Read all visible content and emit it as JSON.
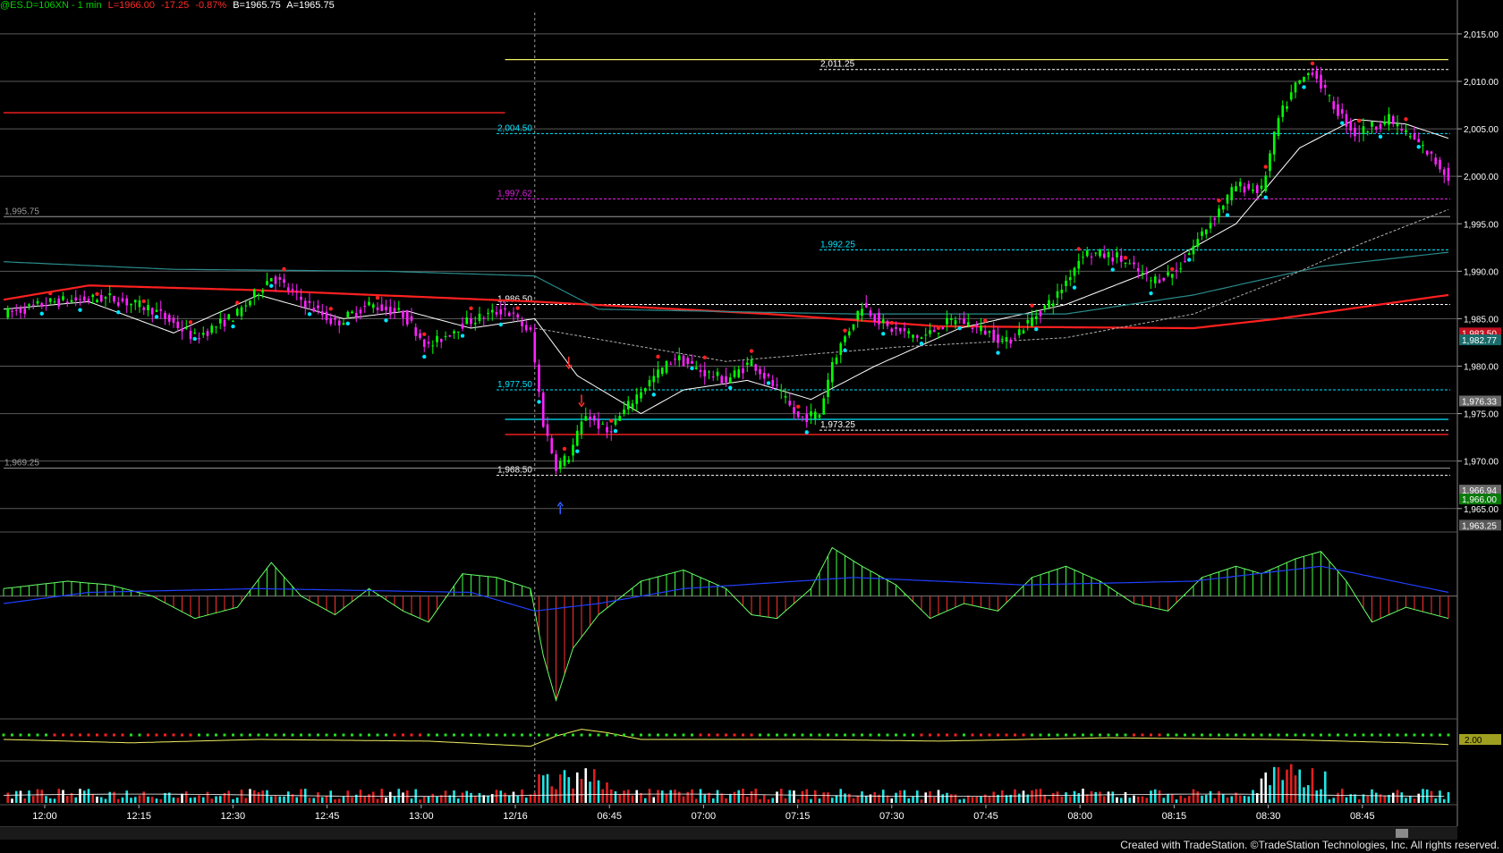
{
  "header": {
    "symbol_interval": "@ES.D=106XN - 1 min",
    "last": "L=1966.00",
    "change": "-17.25",
    "change_pct": "-0.87%",
    "bid": "B=1965.75",
    "ask": "A=1965.75"
  },
  "footer": {
    "credit": "Created with TradeStation. ©TradeStation Technologies, Inc. All rights reserved."
  },
  "colors": {
    "background": "#000000",
    "up_candle": "#00ff00",
    "down_candle": "#ff22ff",
    "ma_red": "#ff2020",
    "ma_white": "#ffffff",
    "teal_band": "#2a8c8c",
    "level_cyan": "#00e5ff",
    "level_magenta": "#e020e0",
    "level_yellow": "#f0f060",
    "hist_up": "#40ff40",
    "hist_down": "#ff3030",
    "signal_blue": "#2040ff",
    "vol_cyan": "#20e5e5",
    "vol_red": "#e02020",
    "vol_white": "#ffffff"
  },
  "chart_data": [
    {
      "panel": "price",
      "type": "candlestick",
      "x_ticks": [
        "12:00",
        "12:15",
        "12:30",
        "12:45",
        "13:00",
        "12/16",
        "06:45",
        "07:00",
        "07:15",
        "07:30",
        "07:45",
        "08:00",
        "08:15",
        "08:30",
        "08:45"
      ],
      "y_ticks": [
        1965,
        1970,
        1975,
        1980,
        1985,
        1990,
        1995,
        2000,
        2005,
        2010,
        2015
      ],
      "y_tick_labels": [
        "1,965.00",
        "1,970.00",
        "1,975.00",
        "1,980.00",
        "1,985.00",
        "1,990.00",
        "1,995.00",
        "2,000.00",
        "2,005.00",
        "2,010.00",
        "2,015.00"
      ],
      "ylim": [
        1963,
        2016.5
      ],
      "close_path": [
        [
          0,
          1985.5
        ],
        [
          12,
          1986.8
        ],
        [
          25,
          1987.2
        ],
        [
          35,
          1986.0
        ],
        [
          45,
          1983.0
        ],
        [
          55,
          1985.5
        ],
        [
          63,
          1989.5
        ],
        [
          70,
          1987.0
        ],
        [
          78,
          1984.5
        ],
        [
          86,
          1986.5
        ],
        [
          94,
          1985.5
        ],
        [
          100,
          1982.0
        ],
        [
          108,
          1984.5
        ],
        [
          118,
          1986.0
        ],
        [
          124,
          1983.5
        ],
        [
          127,
          1974.0
        ],
        [
          130,
          1969.5
        ],
        [
          133,
          1970.5
        ],
        [
          137,
          1975.0
        ],
        [
          142,
          1973.0
        ],
        [
          150,
          1977.5
        ],
        [
          158,
          1981.0
        ],
        [
          164,
          1979.5
        ],
        [
          170,
          1978.5
        ],
        [
          176,
          1980.5
        ],
        [
          182,
          1977.5
        ],
        [
          187,
          1974.5
        ],
        [
          192,
          1975.0
        ],
        [
          195,
          1980.5
        ],
        [
          202,
          1986.5
        ],
        [
          208,
          1984.0
        ],
        [
          216,
          1983.0
        ],
        [
          224,
          1985.0
        ],
        [
          232,
          1983.5
        ],
        [
          236,
          1982.5
        ],
        [
          242,
          1985.0
        ],
        [
          248,
          1987.5
        ],
        [
          254,
          1992.0
        ],
        [
          262,
          1991.5
        ],
        [
          270,
          1989.0
        ],
        [
          276,
          1990.0
        ],
        [
          282,
          1994.0
        ],
        [
          290,
          1999.0
        ],
        [
          296,
          1998.5
        ],
        [
          300,
          2006.0
        ],
        [
          304,
          2009.5
        ],
        [
          308,
          2011.25
        ],
        [
          312,
          2008.0
        ],
        [
          318,
          2004.5
        ],
        [
          326,
          2006.0
        ],
        [
          334,
          2003.0
        ],
        [
          340,
          2000.0
        ]
      ],
      "candle_count": 340,
      "session_break_index": 125,
      "moving_averages": [
        {
          "color": "red",
          "path": [
            [
              0,
              1987.0
            ],
            [
              20,
              1988.5
            ],
            [
              60,
              1988.0
            ],
            [
              125,
              1986.8
            ],
            [
              180,
              1985.5
            ],
            [
              220,
              1984.2
            ],
            [
              280,
              1984.0
            ],
            [
              300,
              1985.0
            ],
            [
              340,
              1987.5
            ]
          ]
        },
        {
          "color": "white",
          "path": [
            [
              0,
              1986.0
            ],
            [
              20,
              1986.8
            ],
            [
              40,
              1983.5
            ],
            [
              60,
              1987.5
            ],
            [
              80,
              1985.0
            ],
            [
              95,
              1985.8
            ],
            [
              110,
              1984.0
            ],
            [
              125,
              1985.0
            ],
            [
              135,
              1979.0
            ],
            [
              150,
              1975.0
            ],
            [
              160,
              1977.5
            ],
            [
              175,
              1978.5
            ],
            [
              190,
              1976.5
            ],
            [
              205,
              1980.0
            ],
            [
              225,
              1984.0
            ],
            [
              250,
              1986.5
            ],
            [
              270,
              1990.0
            ],
            [
              290,
              1995.0
            ],
            [
              305,
              2003.0
            ],
            [
              318,
              2006.0
            ],
            [
              330,
              2005.5
            ],
            [
              340,
              2004.0
            ]
          ]
        },
        {
          "color": "teal",
          "path": [
            [
              0,
              1991.0
            ],
            [
              40,
              1990.2
            ],
            [
              90,
              1990.0
            ],
            [
              125,
              1989.5
            ],
            [
              140,
              1986.0
            ],
            [
              200,
              1985.5
            ],
            [
              250,
              1985.5
            ],
            [
              280,
              1987.5
            ],
            [
              310,
              1990.5
            ],
            [
              340,
              1992.0
            ]
          ]
        },
        {
          "color": "grey-dashed",
          "path": [
            [
              125,
              1984.0
            ],
            [
              170,
              1980.5
            ],
            [
              210,
              1982.0
            ],
            [
              250,
              1983.0
            ],
            [
              280,
              1985.5
            ],
            [
              300,
              1989.0
            ],
            [
              320,
              1993.0
            ],
            [
              340,
              1996.5
            ]
          ]
        }
      ],
      "levels": [
        {
          "label": "2,011.25",
          "value": 2011.25,
          "color": "white",
          "style": "dashed",
          "x_start_index": 192
        },
        {
          "label": "2,004.50",
          "value": 2004.5,
          "color": "cyan",
          "style": "dashed",
          "x_start_index": 116
        },
        {
          "label": "1,997.62",
          "value": 1997.62,
          "color": "magenta",
          "style": "dashed",
          "x_start_index": 116
        },
        {
          "label": "1,992.25",
          "value": 1992.25,
          "color": "cyan",
          "style": "dashed",
          "x_start_index": 192
        },
        {
          "label": "1,986.50",
          "value": 1986.5,
          "color": "white",
          "style": "dashed",
          "x_start_index": 116
        },
        {
          "label": "1,977.50",
          "value": 1977.5,
          "color": "cyan",
          "style": "dashed",
          "x_start_index": 116
        },
        {
          "label": "1,973.25",
          "value": 1973.25,
          "color": "white",
          "style": "dashed",
          "x_start_index": 192
        },
        {
          "label": "1,968.50",
          "value": 1968.5,
          "color": "white",
          "style": "dashed",
          "x_start_index": 116
        },
        {
          "label": "1,995.75",
          "value": 1995.75,
          "color": "grey",
          "style": "solid",
          "x_start_index": 0
        },
        {
          "label": "1,969.25",
          "value": 1969.25,
          "color": "grey",
          "style": "solid",
          "x_start_index": 0
        }
      ],
      "solid_lines": [
        {
          "value": 2012.3,
          "color": "yellow",
          "x_range_index": [
            118,
            340
          ]
        },
        {
          "value": 2006.7,
          "color": "red",
          "x_range_index": [
            0,
            118
          ]
        },
        {
          "value": 1974.4,
          "color": "cyan",
          "x_range_index": [
            118,
            340
          ]
        },
        {
          "value": 1972.8,
          "color": "red",
          "x_range_index": [
            118,
            340
          ]
        }
      ],
      "price_flags": [
        {
          "label": "1,983.50",
          "value": 1983.5,
          "color": "#c01020"
        },
        {
          "label": "1,982.77",
          "value": 1982.77,
          "color": "#1a6a6a"
        },
        {
          "label": "1,976.33",
          "value": 1976.33,
          "color": "#6a6a6a"
        },
        {
          "label": "1,966.94",
          "value": 1966.94,
          "color": "#6a6a6a"
        },
        {
          "label": "1,966.00",
          "value": 1966.0,
          "color": "#0a7a0a"
        },
        {
          "label": "1,963.25",
          "value": 1963.25,
          "color": "#5a5a5a"
        }
      ]
    },
    {
      "panel": "oscillator",
      "type": "histogram",
      "series_path": [
        [
          0,
          1
        ],
        [
          15,
          2
        ],
        [
          25,
          1.5
        ],
        [
          35,
          0
        ],
        [
          45,
          -3
        ],
        [
          55,
          -1.5
        ],
        [
          63,
          4.5
        ],
        [
          70,
          0
        ],
        [
          78,
          -2.5
        ],
        [
          86,
          1
        ],
        [
          94,
          -2
        ],
        [
          100,
          -3.5
        ],
        [
          108,
          3
        ],
        [
          116,
          2.5
        ],
        [
          124,
          1
        ],
        [
          127,
          -8
        ],
        [
          130,
          -14
        ],
        [
          134,
          -7
        ],
        [
          140,
          -2.5
        ],
        [
          150,
          2
        ],
        [
          160,
          3.5
        ],
        [
          170,
          1
        ],
        [
          176,
          -2.5
        ],
        [
          182,
          -3
        ],
        [
          190,
          1
        ],
        [
          195,
          6.5
        ],
        [
          202,
          4
        ],
        [
          210,
          1.5
        ],
        [
          218,
          -3
        ],
        [
          226,
          -1
        ],
        [
          234,
          -2
        ],
        [
          242,
          2.5
        ],
        [
          250,
          4
        ],
        [
          258,
          2
        ],
        [
          266,
          -1
        ],
        [
          274,
          -2
        ],
        [
          282,
          2.5
        ],
        [
          290,
          4
        ],
        [
          296,
          3
        ],
        [
          304,
          5
        ],
        [
          310,
          6
        ],
        [
          316,
          2
        ],
        [
          322,
          -3.5
        ],
        [
          330,
          -1.5
        ],
        [
          340,
          -3
        ]
      ],
      "signal_path": [
        [
          0,
          -1
        ],
        [
          20,
          0.5
        ],
        [
          60,
          1
        ],
        [
          110,
          0.5
        ],
        [
          125,
          -2
        ],
        [
          140,
          -1
        ],
        [
          160,
          1
        ],
        [
          200,
          2.5
        ],
        [
          240,
          1.5
        ],
        [
          280,
          2
        ],
        [
          310,
          4
        ],
        [
          340,
          0.5
        ]
      ],
      "ylim": [
        -16,
        8
      ]
    },
    {
      "panel": "indicator",
      "type": "line",
      "flag": "2.00",
      "series_path": [
        [
          0,
          2.0
        ],
        [
          30,
          1.8
        ],
        [
          60,
          2.0
        ],
        [
          100,
          1.9
        ],
        [
          124,
          1.6
        ],
        [
          130,
          2.2
        ],
        [
          136,
          2.6
        ],
        [
          142,
          2.4
        ],
        [
          150,
          2.0
        ],
        [
          190,
          2.0
        ],
        [
          220,
          1.9
        ],
        [
          260,
          2.1
        ],
        [
          300,
          2.0
        ],
        [
          330,
          1.8
        ],
        [
          340,
          1.7
        ]
      ],
      "signal_dots": "green with red segments"
    },
    {
      "panel": "volume",
      "type": "bar",
      "bar_count": 340,
      "ylim": [
        0,
        10
      ]
    }
  ]
}
